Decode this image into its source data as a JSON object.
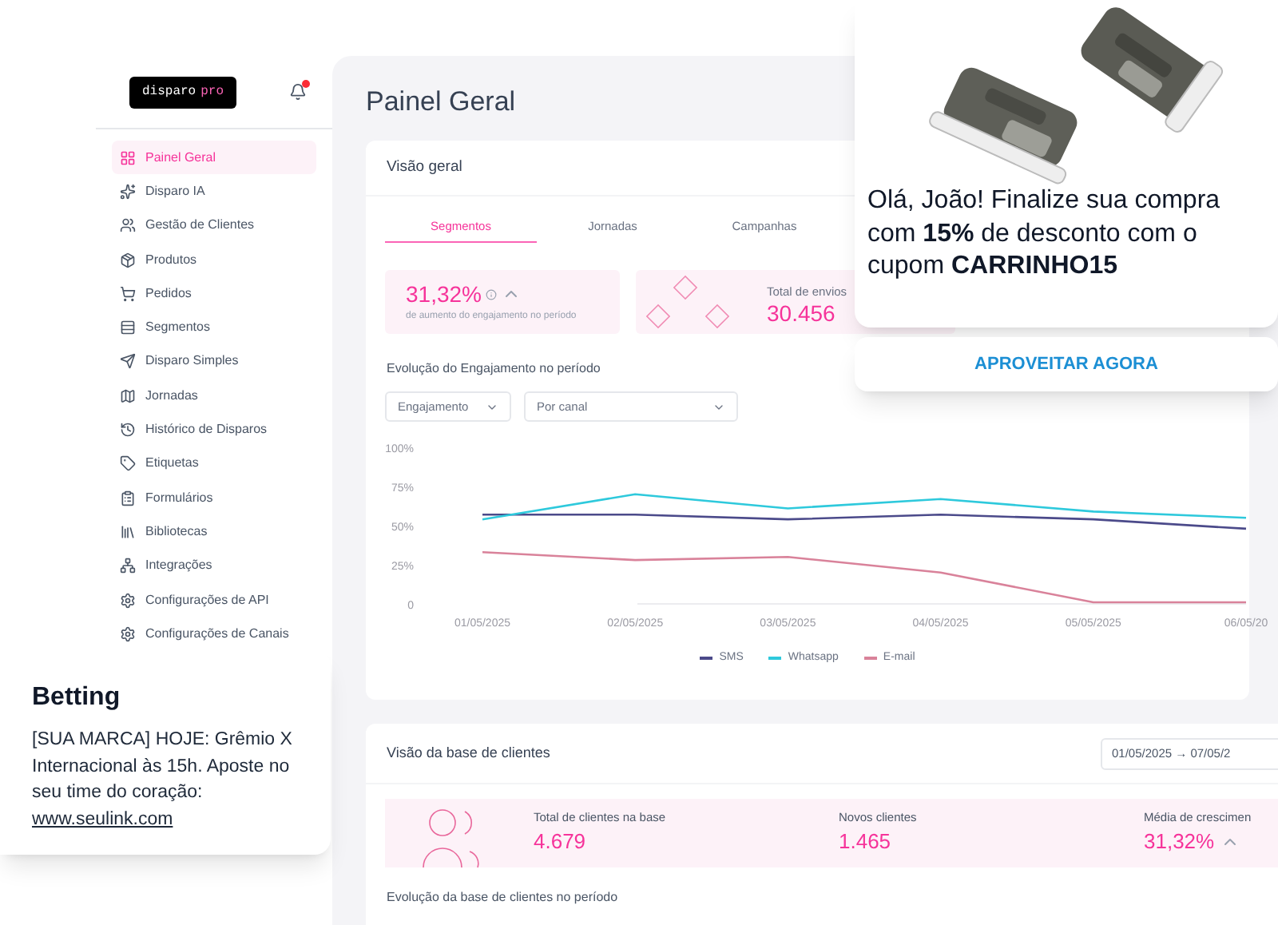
{
  "sidebar": {
    "logo": {
      "text": "disparo",
      "accent": "pro"
    },
    "has_notification": true,
    "items": [
      {
        "label": "Painel Geral",
        "selected": true
      },
      {
        "label": "Disparo IA",
        "selected": false
      },
      {
        "label": "Gestão de Clientes",
        "selected": false
      },
      {
        "label": "Produtos",
        "selected": false
      },
      {
        "label": "Pedidos",
        "selected": false
      },
      {
        "label": "Segmentos",
        "selected": false
      },
      {
        "label": "Disparo Simples",
        "selected": false
      },
      {
        "label": "Jornadas",
        "selected": false
      },
      {
        "label": "Histórico de Disparos",
        "selected": false
      },
      {
        "label": "Etiquetas",
        "selected": false
      },
      {
        "label": "Formulários",
        "selected": false
      },
      {
        "label": "Bibliotecas",
        "selected": false
      },
      {
        "label": "Integrações",
        "selected": false
      },
      {
        "label": "Configurações de API",
        "selected": false
      },
      {
        "label": "Configurações de Canais",
        "selected": false
      }
    ]
  },
  "page_title": "Painel Geral",
  "overview": {
    "title": "Visão geral",
    "tabs": [
      {
        "label": "Segmentos",
        "selected": true
      },
      {
        "label": "Jornadas",
        "selected": false
      },
      {
        "label": "Campanhas",
        "selected": false
      }
    ],
    "stats": [
      {
        "value": "31,32%",
        "caption": "de aumento do engajamento no período",
        "trend_up": true
      },
      {
        "label": "Total de envios",
        "value": "30.456"
      }
    ],
    "chart_title": "Evolução do Engajamento no período",
    "filters": [
      {
        "value": "Engajamento"
      },
      {
        "value": "Por canal"
      }
    ],
    "chart_data": {
      "type": "line",
      "categories": [
        "01/05/2025",
        "02/05/2025",
        "03/05/2025",
        "04/05/2025",
        "05/05/2025",
        "06/05/20"
      ],
      "yticks": [
        {
          "value": 0,
          "label": "0"
        },
        {
          "value": 25,
          "label": "25%"
        },
        {
          "value": 50,
          "label": "50%"
        },
        {
          "value": 75,
          "label": "75%"
        },
        {
          "value": 100,
          "label": "100%"
        }
      ],
      "ylim": [
        0,
        100
      ],
      "legend": true,
      "series": [
        {
          "name": "SMS",
          "color": "#4b4a8a",
          "values": [
            57,
            57,
            54,
            57,
            54,
            48
          ]
        },
        {
          "name": "Whatsapp",
          "color": "#2ec9dc",
          "values": [
            54,
            70,
            61,
            67,
            59,
            55
          ]
        },
        {
          "name": "E-mail",
          "color": "#d9829a",
          "values": [
            33,
            28,
            30,
            20,
            1,
            1
          ]
        }
      ]
    }
  },
  "clients": {
    "title": "Visão da base de clientes",
    "date_range": "01/05/2025 → 07/05/2",
    "stats": [
      {
        "label": "Total de clientes na base",
        "value": "4.679"
      },
      {
        "label": "Novos clientes",
        "value": "1.465"
      },
      {
        "label": "Média de crescimen",
        "value": "31,32%",
        "trend_up": true
      }
    ],
    "chart_title": "Evolução da base de clientes no período"
  },
  "promo": {
    "message": "Olá, João! Finalize sua compra com **15%** de desconto com o cupom **CARRINHO15**",
    "button": "APROVEITAR AGORA"
  },
  "sms": {
    "title": "Betting",
    "message": "[SUA MARCA] HOJE: Grêmio X Internacional às 15h. Aposte no seu time do coração:",
    "link": "www.seulink.com"
  }
}
